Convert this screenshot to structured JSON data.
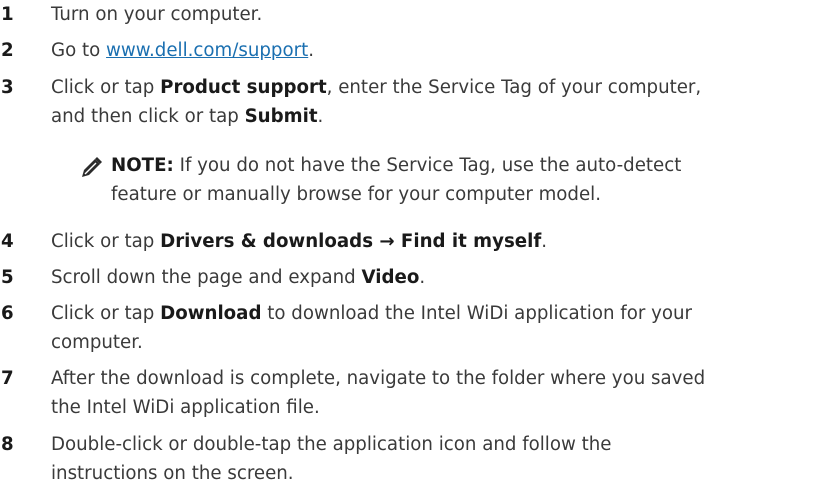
{
  "steps": [
    {
      "num": "1",
      "text": "Turn on your computer."
    },
    {
      "num": "2",
      "prefix": "Go to ",
      "link": "www.dell.com/support",
      "suffix": "."
    },
    {
      "num": "3",
      "a": "Click or tap ",
      "b1": "Product support",
      "c": ", enter the Service Tag of your computer,",
      "d": "and then click or tap ",
      "b2": "Submit",
      "e": "."
    },
    {
      "num": "4",
      "a": "Click or tap ",
      "b1": "Drivers & downloads → Find it myself",
      "c": "."
    },
    {
      "num": "5",
      "a": "Scroll down the page and expand ",
      "b1": "Video",
      "c": "."
    },
    {
      "num": "6",
      "a": "Click or tap ",
      "b1": "Download",
      "c": " to download the Intel WiDi application for your",
      "d": "computer."
    },
    {
      "num": "7",
      "line1": "After the download is complete, navigate to the folder where you saved",
      "line2": "the Intel WiDi application file."
    },
    {
      "num": "8",
      "line1": "Double-click or double-tap the application icon and follow the",
      "line2": "instructions on the screen."
    }
  ],
  "note": {
    "icon": "note-pencil-icon",
    "label": "NOTE:",
    "line1": " If you do not have the Service Tag, use the auto-detect",
    "line2": "feature or manually browse for your computer model."
  }
}
